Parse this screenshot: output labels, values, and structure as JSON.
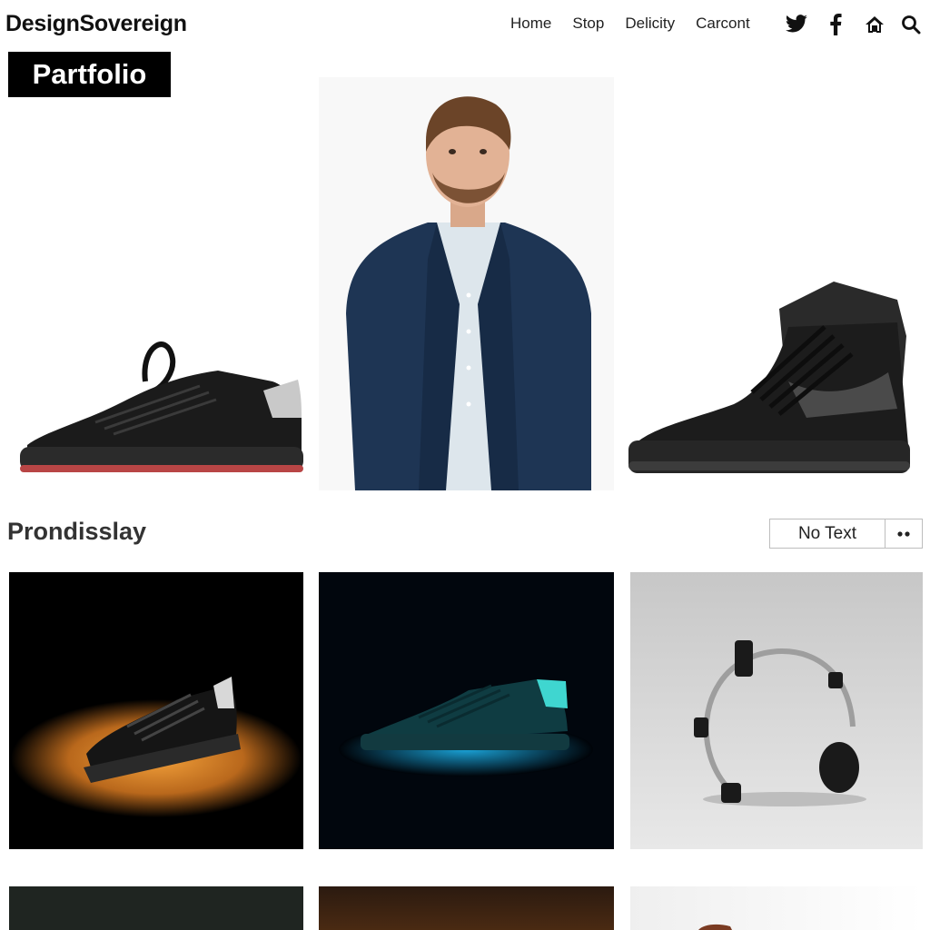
{
  "header": {
    "brand": "DesignSovereign",
    "nav": [
      "Home",
      "Stop",
      "Delicity",
      "Carcont"
    ],
    "icons": [
      "twitter-icon",
      "facebook-icon",
      "home-icon",
      "search-icon"
    ]
  },
  "hero": {
    "badge": "Partfolio",
    "images": [
      "black-sneaker-low-top",
      "man-in-navy-blazer-portrait",
      "black-high-top-sneaker"
    ]
  },
  "section": {
    "title": "Prondisslay",
    "button_label": "No Text",
    "more_icon": "more-dots-icon"
  },
  "grid": {
    "row1": [
      "sneaker-orange-spotlight",
      "sneaker-teal-glow",
      "headset-on-grey"
    ],
    "row2": [
      "dark-green-tile",
      "dark-brown-tile",
      "light-tile"
    ]
  }
}
